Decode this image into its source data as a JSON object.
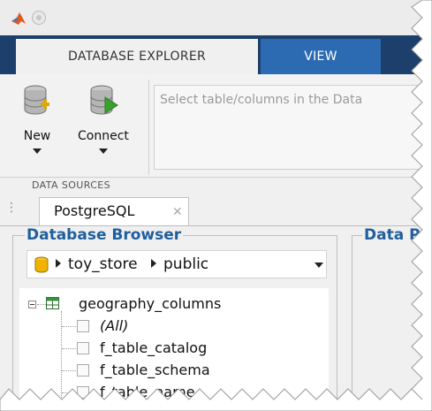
{
  "titlebar": {
    "logo_icon": "matlab-logo-icon",
    "button_icon": "window-circle-button-icon"
  },
  "tabs": [
    {
      "label": "DATABASE EXPLORER",
      "active": true
    },
    {
      "label": "VIEW",
      "active": false
    }
  ],
  "ribbon": {
    "new_label": "New",
    "connect_label": "Connect",
    "group_label": "DATA SOURCES",
    "info_text": "Select table/columns in the Data"
  },
  "document_tab": {
    "label": "PostgreSQL",
    "close_icon": "close-icon"
  },
  "database_browser": {
    "title": "Database Browser",
    "breadcrumb": {
      "database": "toy_store",
      "schema": "public"
    },
    "tree": {
      "table": "geography_columns",
      "columns": [
        "(All)",
        "f_table_catalog",
        "f_table_schema",
        "f_table_name"
      ]
    }
  },
  "data_panel": {
    "title": "Data P"
  },
  "colors": {
    "tabbar": "#1d3f6b",
    "view_tab": "#2c6bb2",
    "panel_title": "#1f5f9e"
  }
}
